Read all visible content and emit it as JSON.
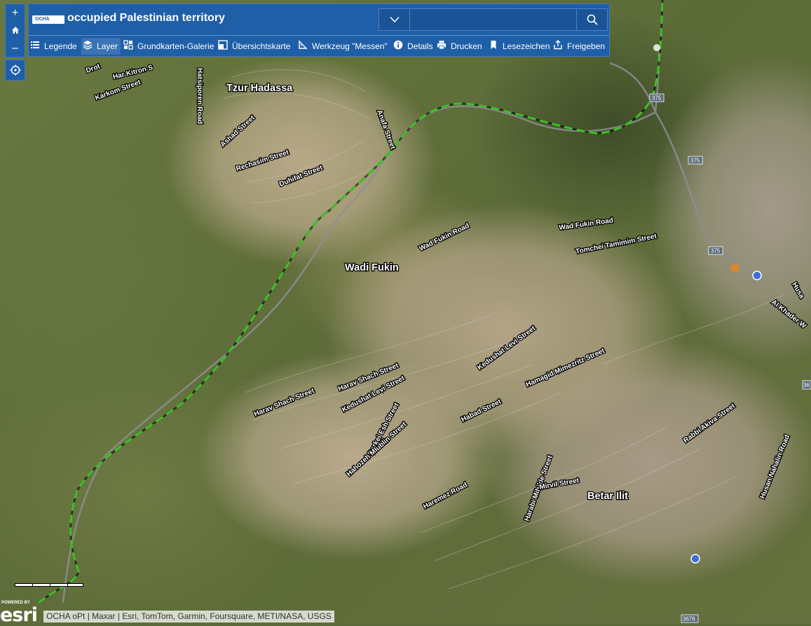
{
  "header": {
    "logo_text": "OCHA",
    "title": "occupied Palestinian territory",
    "search": {
      "placeholder": ""
    }
  },
  "toolbar": [
    {
      "label": "Legende",
      "icon": "list-icon"
    },
    {
      "label": "Layer",
      "icon": "layers-icon",
      "active": true
    },
    {
      "label": "Grundkarten-Galerie",
      "icon": "basemap-gallery-icon"
    },
    {
      "label": "Übersichtskarte",
      "icon": "overview-map-icon"
    },
    {
      "label": "Werkzeug \"Messen\"",
      "icon": "measure-icon"
    },
    {
      "label": "Details",
      "icon": "info-icon"
    },
    {
      "label": "Drucken",
      "icon": "print-icon"
    },
    {
      "label": "Lesezeichen",
      "icon": "bookmark-icon"
    },
    {
      "label": "Freigeben",
      "icon": "share-icon"
    }
  ],
  "controls": {
    "zoom_in": "+",
    "zoom_out": "–",
    "home_icon": "home-icon",
    "locate_icon": "locate-icon"
  },
  "map": {
    "places": [
      "Tzur Hadassa",
      "Wadi Fukin",
      "Betar Ilit"
    ],
    "roads": [
      "Har Kitron S",
      "Karkom Street",
      "Drot",
      "Hatsiporen Road",
      "Ashad Street",
      "Rechasim Street",
      "Duhifat Street",
      "Anafa Street",
      "Wad Fukin Road",
      "Wad Fukin Road",
      "Tomchei Tamimim Street",
      "Al Khader W",
      "Husa",
      "Kedushat Levi Street",
      "Hamagid Mimezritz Street",
      "Harav Shach Street",
      "Harav Shach Street",
      "Kedushat Levi Street",
      "Darkei Esh Street",
      "Hahozeh Mlublin Street",
      "Habad Street",
      "Rabbi Akiva Street",
      "Husan Nahalin Road",
      "Haremez Road",
      "Harabi Mibikle Street",
      "Mirvil Street"
    ],
    "route_shields": [
      "375",
      "375",
      "375",
      "3676"
    ],
    "edge_label": "36"
  },
  "esri": {
    "powered_by": "POWERED BY",
    "logo": "esri"
  },
  "attribution": "OCHA oPt | Maxar | Esri, TomTom, Garmin, Foursquare, METI/NASA, USGS"
}
